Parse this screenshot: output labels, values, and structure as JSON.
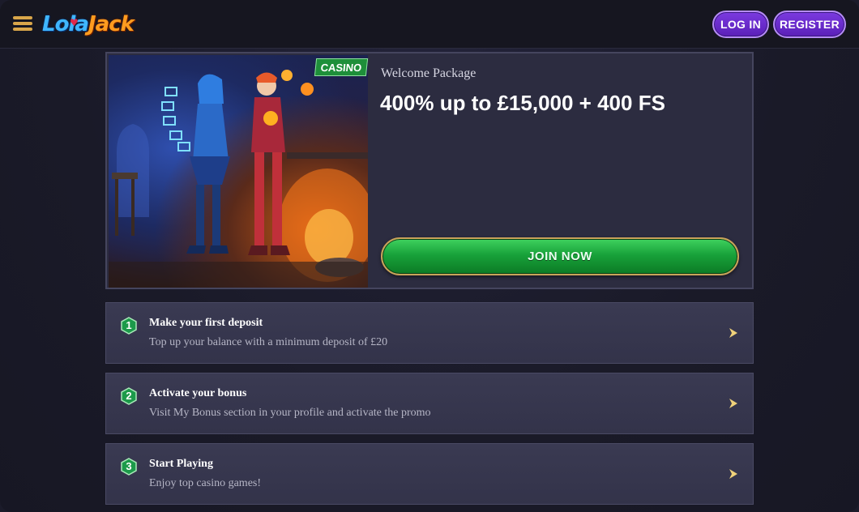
{
  "header": {
    "logo_part1": "Lola",
    "logo_part2": "Jack",
    "login_label": "LOG IN",
    "register_label": "REGISTER"
  },
  "promo": {
    "tag": "CASINO",
    "subtitle": "Welcome Package",
    "title": "400% up to £15,000 + 400 FS",
    "cta_label": "JOIN NOW"
  },
  "steps": [
    {
      "number": "1",
      "title": "Make your first deposit",
      "description": "Top up your balance with a minimum deposit of £20"
    },
    {
      "number": "2",
      "title": "Activate your bonus",
      "description": "Visit My Bonus section in your profile and activate the promo"
    },
    {
      "number": "3",
      "title": "Start Playing",
      "description": "Enjoy top casino games!"
    }
  ],
  "colors": {
    "accent_purple": "#6b2fd0",
    "cta_green": "#18a23a",
    "gold": "#d9a64a",
    "background": "#1b1b2a"
  },
  "icons": {
    "menu": "hamburger-menu-icon",
    "step_arrow": "chevron-right-icon",
    "step_badge": "hexagon-number-badge"
  }
}
